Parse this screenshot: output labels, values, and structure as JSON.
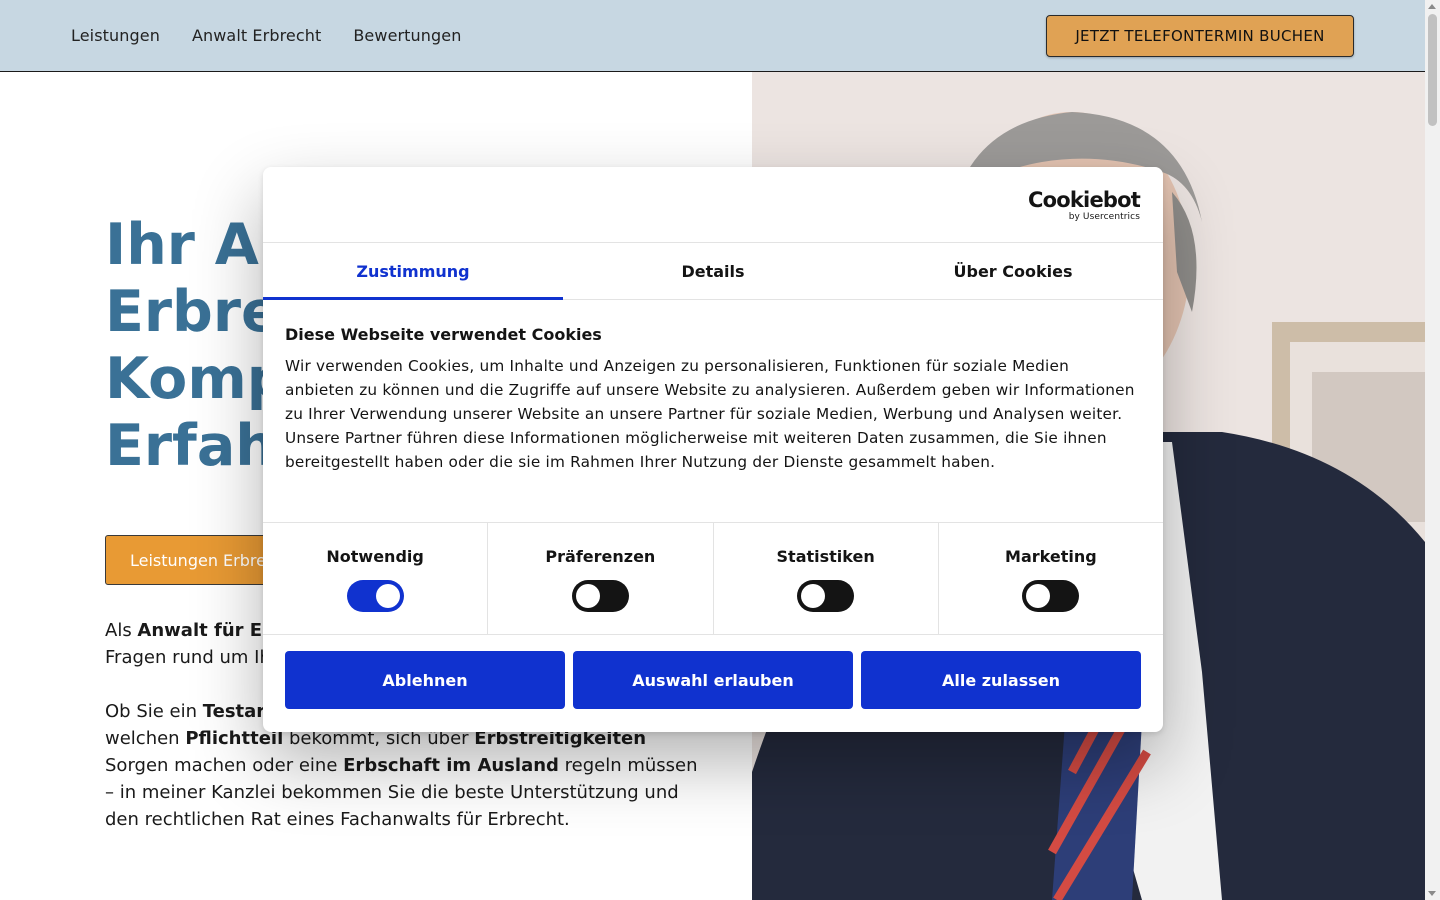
{
  "header": {
    "nav": [
      "Leistungen",
      "Anwalt Erbrecht",
      "Bewertungen"
    ],
    "cta": "JETZT TELEFONTERMIN BUCHEN"
  },
  "hero": {
    "title_lines": "Ihr An\nErbre\nKomp\nErfah",
    "button": "Leistungen Erbre",
    "para1": [
      {
        "t": "Als ",
        "b": false
      },
      {
        "t": "Anwalt für E",
        "b": true
      },
      {
        "t": "\nFragen rund um Ih",
        "b": false
      }
    ],
    "para2": [
      {
        "t": "Ob Sie ein ",
        "b": false
      },
      {
        "t": "Testar",
        "b": true
      },
      {
        "t": "\nwelchen ",
        "b": false
      },
      {
        "t": "Pflichtteil",
        "b": true
      },
      {
        "t": " bekommt, sich über ",
        "b": false
      },
      {
        "t": "Erbstreitigkeiten",
        "b": true
      },
      {
        "t": "\nSorgen machen oder eine ",
        "b": false
      },
      {
        "t": "Erbschaft im Ausland",
        "b": true
      },
      {
        "t": " regeln müssen\n– in meiner Kanzlei bekommen Sie die beste Unterstützung und\nden rechtlichen Rat eines Fachanwalts für Erbrecht.",
        "b": false
      }
    ]
  },
  "cookie": {
    "logo": "Cookiebot",
    "logo_sub": "by Usercentrics",
    "tabs": [
      {
        "label": "Zustimmung",
        "active": true
      },
      {
        "label": "Details",
        "active": false
      },
      {
        "label": "Über Cookies",
        "active": false
      }
    ],
    "heading": "Diese Webseite verwendet Cookies",
    "text": "Wir verwenden Cookies, um Inhalte und Anzeigen zu personalisieren, Funktionen für soziale Medien anbieten zu können und die Zugriffe auf unsere Website zu analysieren. Außerdem geben wir Informationen zu Ihrer Verwendung unserer Website an unsere Partner für soziale Medien, Werbung und Analysen weiter. Unsere Partner führen diese Informationen möglicherweise mit weiteren Daten zusammen, die Sie ihnen bereitgestellt haben oder die sie im Rahmen Ihrer Nutzung der Dienste gesammelt haben.",
    "toggles": [
      {
        "label": "Notwendig",
        "on": true
      },
      {
        "label": "Präferenzen",
        "on": false
      },
      {
        "label": "Statistiken",
        "on": false
      },
      {
        "label": "Marketing",
        "on": false
      }
    ],
    "buttons": [
      "Ablehnen",
      "Auswahl erlauben",
      "Alle zulassen"
    ]
  },
  "colors": {
    "header_bg": "#c7d7e2",
    "accent_orange": "#e89a34",
    "title_blue": "#3a7196",
    "cookie_blue": "#1032cf"
  }
}
